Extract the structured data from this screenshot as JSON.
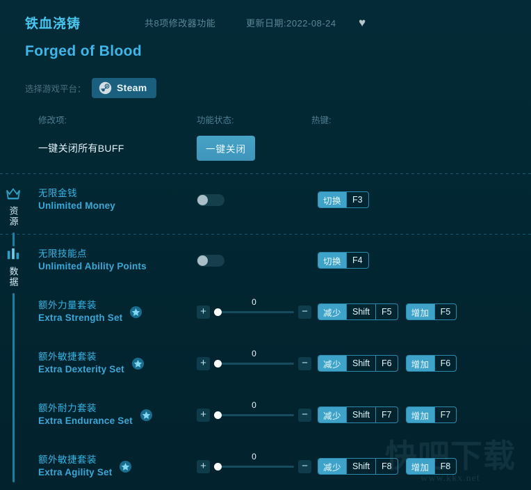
{
  "header": {
    "title_cn": "铁血浇铸",
    "title_en": "Forged of Blood",
    "feature_count": "共8项修改器功能",
    "update_date": "更新日期:2022-08-24",
    "favorite_icon": "heart-icon",
    "platform_label": "选择游戏平台：",
    "platform_button": "Steam"
  },
  "columns": {
    "modification": "修改项:",
    "state": "功能状态:",
    "hotkey": "热键:"
  },
  "master": {
    "name": "一键关闭所有BUFF",
    "button": "一键关闭"
  },
  "sections": [
    {
      "id": "resources",
      "icon": "crown-icon",
      "label": "资源",
      "rows": [
        {
          "name_cn": "无限金钱",
          "name_en": "Unlimited Money",
          "control": "toggle",
          "toggle_on": false,
          "starred": false,
          "hotkeys": [
            {
              "action": "切换",
              "keys": [
                "F3"
              ]
            }
          ]
        }
      ]
    },
    {
      "id": "data",
      "icon": "bar-chart-icon",
      "label": "数据",
      "rows": [
        {
          "name_cn": "无限技能点",
          "name_en": "Unlimited Ability Points",
          "control": "toggle",
          "toggle_on": false,
          "starred": false,
          "hotkeys": [
            {
              "action": "切换",
              "keys": [
                "F4"
              ]
            }
          ]
        },
        {
          "name_cn": "额外力量套装",
          "name_en": "Extra Strength Set",
          "control": "slider",
          "value": "0",
          "starred": true,
          "plus": "+",
          "minus": "−",
          "hotkeys": [
            {
              "action": "减少",
              "keys": [
                "Shift",
                "F5"
              ]
            },
            {
              "action": "增加",
              "keys": [
                "F5"
              ]
            }
          ]
        },
        {
          "name_cn": "额外敏捷套装",
          "name_en": "Extra Dexterity Set",
          "control": "slider",
          "value": "0",
          "starred": true,
          "plus": "+",
          "minus": "−",
          "hotkeys": [
            {
              "action": "减少",
              "keys": [
                "Shift",
                "F6"
              ]
            },
            {
              "action": "增加",
              "keys": [
                "F6"
              ]
            }
          ]
        },
        {
          "name_cn": "额外耐力套装",
          "name_en": "Extra Endurance Set",
          "control": "slider",
          "value": "0",
          "starred": true,
          "plus": "+",
          "minus": "−",
          "hotkeys": [
            {
              "action": "减少",
              "keys": [
                "Shift",
                "F7"
              ]
            },
            {
              "action": "增加",
              "keys": [
                "F7"
              ]
            }
          ]
        },
        {
          "name_cn": "额外敏捷套装",
          "name_en": "Extra Agility Set",
          "control": "slider",
          "value": "0",
          "starred": true,
          "plus": "+",
          "minus": "−",
          "hotkeys": [
            {
              "action": "减少",
              "keys": [
                "Shift",
                "F8"
              ]
            },
            {
              "action": "增加",
              "keys": [
                "F8"
              ]
            }
          ]
        }
      ]
    }
  ],
  "watermark": {
    "logo": "快吧下载",
    "url": "www.kkx.net"
  },
  "colors": {
    "background": "#022732",
    "accent": "#3fa2c9",
    "title": "#49c6f0",
    "name_cn": "#36b4e4",
    "name_en": "#3aa7d6",
    "muted": "#4e7f92"
  }
}
